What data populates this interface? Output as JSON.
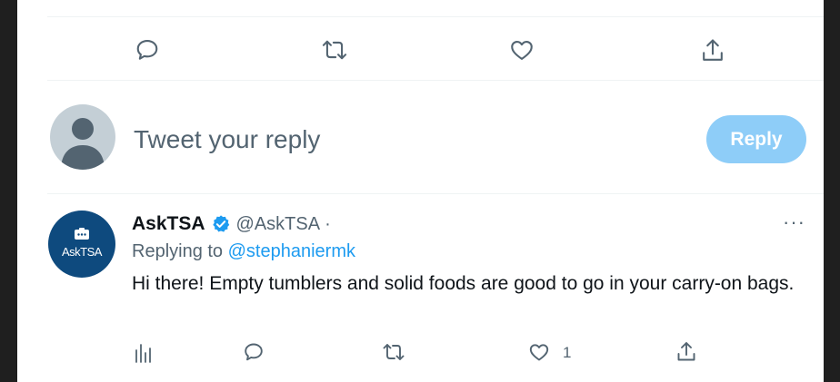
{
  "top_actions": {
    "icons": [
      "reply-icon",
      "retweet-icon",
      "like-icon",
      "share-icon"
    ]
  },
  "composer": {
    "placeholder": "Tweet your reply",
    "reply_button_label": "Reply"
  },
  "reply": {
    "avatar_logo_text": "AskTSA",
    "display_name": "AskTSA",
    "handle": "@AskTSA",
    "separator": "·",
    "replying_to_label": "Replying to",
    "replying_to_handle": "@stephaniermk",
    "text": "Hi there! Empty tumblers and solid foods are good to go in your carry-on bags.",
    "more_label": "···",
    "like_count": "1",
    "icons": [
      "analytics-icon",
      "reply-icon",
      "retweet-icon",
      "like-icon",
      "share-icon"
    ]
  },
  "colors": {
    "accent": "#1d9bf0",
    "reply_button_disabled": "#8ecdf8",
    "tsa_brand": "#0e4a7e",
    "secondary_text": "#536471",
    "primary_text": "#0f1419"
  }
}
